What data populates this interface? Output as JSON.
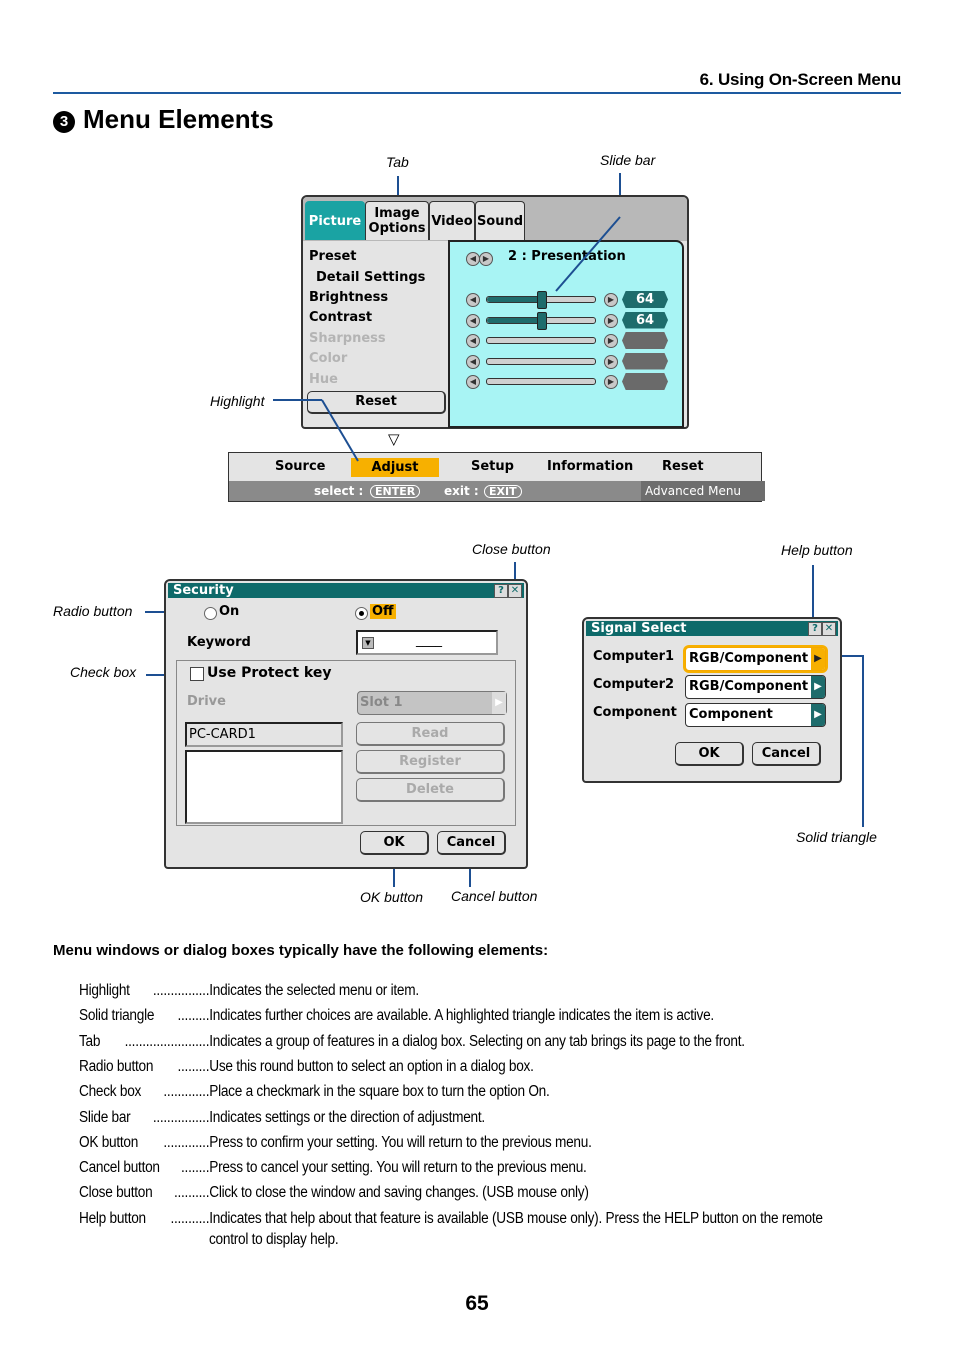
{
  "header": {
    "section_title": "6. Using On-Screen Menu",
    "heading_number": "3",
    "heading": "Menu Elements"
  },
  "callouts": {
    "tab": "Tab",
    "slide_bar": "Slide bar",
    "highlight": "Highlight",
    "close_button": "Close button",
    "help_button": "Help button",
    "radio_button": "Radio button",
    "check_box": "Check box",
    "ok_button": "OK button",
    "cancel_button": "Cancel button",
    "solid_triangle": "Solid triangle"
  },
  "picture_menu": {
    "tabs": [
      {
        "label": "Picture",
        "active": true
      },
      {
        "label": "Image\nOptions",
        "active": false
      },
      {
        "label": "Video",
        "active": false
      },
      {
        "label": "Sound",
        "active": false
      }
    ],
    "items": [
      {
        "label": "Preset",
        "enabled": true
      },
      {
        "label": "Detail Settings",
        "enabled": true
      },
      {
        "label": "Brightness",
        "enabled": true
      },
      {
        "label": "Contrast",
        "enabled": true
      },
      {
        "label": "Sharpness",
        "enabled": false
      },
      {
        "label": "Color",
        "enabled": false
      },
      {
        "label": "Hue",
        "enabled": false
      }
    ],
    "reset_label": "Reset",
    "preset_value": "2 : Presentation",
    "sliders": [
      {
        "name": "brightness",
        "value": "64",
        "fraction": 0.5
      },
      {
        "name": "contrast",
        "value": "64",
        "fraction": 0.5
      },
      {
        "name": "sharpness",
        "value": "",
        "fraction": null
      },
      {
        "name": "color",
        "value": "",
        "fraction": null
      },
      {
        "name": "hue",
        "value": "",
        "fraction": null
      }
    ]
  },
  "menu_bar": {
    "pointer": "▽",
    "items": [
      {
        "label": "Source",
        "active": false
      },
      {
        "label": "Adjust",
        "active": true
      },
      {
        "label": "Setup",
        "active": false
      },
      {
        "label": "Information",
        "active": false
      },
      {
        "label": "Reset",
        "active": false
      }
    ],
    "select_hint": "select :",
    "enter_key": "ENTER",
    "exit_hint": "exit :",
    "exit_key": "EXIT",
    "mode": "Advanced Menu",
    "highlight_color": "#f7b000"
  },
  "security_dialog": {
    "title": "Security",
    "help_icon": "?",
    "close_icon": "✕",
    "radio_on": "On",
    "radio_off": "Off",
    "selected": "Off",
    "keyword_label": "Keyword",
    "keyword_value": "____",
    "use_protect_key": "Use Protect key",
    "use_protect_checked": false,
    "drive_label": "Drive",
    "drive_value": "Slot 1",
    "card_name": "PC-CARD1",
    "read": "Read",
    "register": "Register",
    "delete": "Delete",
    "ok": "OK",
    "cancel": "Cancel"
  },
  "signal_dialog": {
    "title": "Signal Select",
    "help_icon": "?",
    "close_icon": "✕",
    "rows": [
      {
        "label": "Computer1",
        "value": "RGB/Component",
        "active": true
      },
      {
        "label": "Computer2",
        "value": "RGB/Component",
        "active": false
      },
      {
        "label": "Component",
        "value": "Component",
        "active": false
      }
    ],
    "ok": "OK",
    "cancel": "Cancel"
  },
  "body": {
    "intro": "Menu windows or dialog boxes typically have the following elements:",
    "definitions": [
      {
        "term": "Highlight",
        "dots": "................",
        "text": "Indicates the selected menu or item."
      },
      {
        "term": "Solid triangle",
        "dots": ".........",
        "text": "Indicates further choices are available. A highlighted triangle indicates the item is active."
      },
      {
        "term": "Tab",
        "dots": "........................",
        "text": "Indicates a group of features in a dialog box. Selecting on any tab brings its page to the front."
      },
      {
        "term": "Radio button",
        "dots": ".........",
        "text": "Use this round button to select an option in a dialog box."
      },
      {
        "term": "Check box",
        "dots": ".............",
        "text": "Place a checkmark in the square box to turn the option On."
      },
      {
        "term": "Slide bar",
        "dots": "................",
        "text": "Indicates settings or the direction of adjustment."
      },
      {
        "term": "OK button",
        "dots": ".............",
        "text": "Press to confirm your setting. You will return to the previous menu."
      },
      {
        "term": "Cancel button",
        "dots": "........",
        "text": "Press to cancel your setting. You will return to the previous menu."
      },
      {
        "term": "Close button",
        "dots": "..........",
        "text": "Click to close the window and saving changes. (USB mouse only)"
      },
      {
        "term": "Help button",
        "dots": "...........",
        "text": "Indicates that help about that feature is available (USB mouse only). Press the HELP button on the remote",
        "cont": "control to display help."
      }
    ]
  },
  "page_number": "65"
}
